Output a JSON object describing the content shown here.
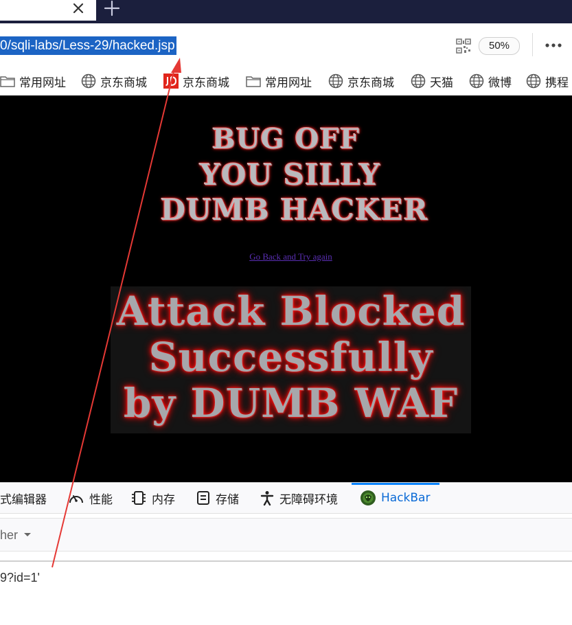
{
  "browser": {
    "url": "0/sqli-labs/Less-29/hacked.jsp",
    "zoom": "50%"
  },
  "bookmarks": [
    {
      "label": "常用网址",
      "icon": "folder-icon"
    },
    {
      "label": "京东商城",
      "icon": "globe-icon"
    },
    {
      "label": "京东商城",
      "icon": "jd-logo-icon"
    },
    {
      "label": "常用网址",
      "icon": "folder-icon"
    },
    {
      "label": "京东商城",
      "icon": "globe-icon"
    },
    {
      "label": "天猫",
      "icon": "globe-icon"
    },
    {
      "label": "微博",
      "icon": "globe-icon"
    },
    {
      "label": "携程",
      "icon": "globe-icon"
    }
  ],
  "page": {
    "banner_lines": [
      "BUG OFF",
      "YOU SILLY",
      "DUMB HACKER"
    ],
    "link": "Go Back and Try again",
    "blocked_lines": [
      "Attack Blocked",
      "Successfully",
      "by DUMB WAF"
    ]
  },
  "devtools": {
    "tabs": [
      {
        "label": "式编辑器",
        "icon": ""
      },
      {
        "label": "性能",
        "icon": "performance-gauge-icon"
      },
      {
        "label": "内存",
        "icon": "memory-chip-icon"
      },
      {
        "label": "存储",
        "icon": "storage-icon"
      },
      {
        "label": "无障碍环境",
        "icon": "accessibility-icon"
      },
      {
        "label": "HackBar",
        "icon": "hackbar-logo-icon",
        "active": true
      }
    ],
    "accent": "#0a84ff"
  },
  "hackbar": {
    "select_label": "her",
    "input_text": "9?id=1'"
  },
  "colors": {
    "tabstrip": "#1b1f3d",
    "url_highlight": "#1c64c4",
    "annotation": "#e53935",
    "link": "#5b2fb5"
  }
}
